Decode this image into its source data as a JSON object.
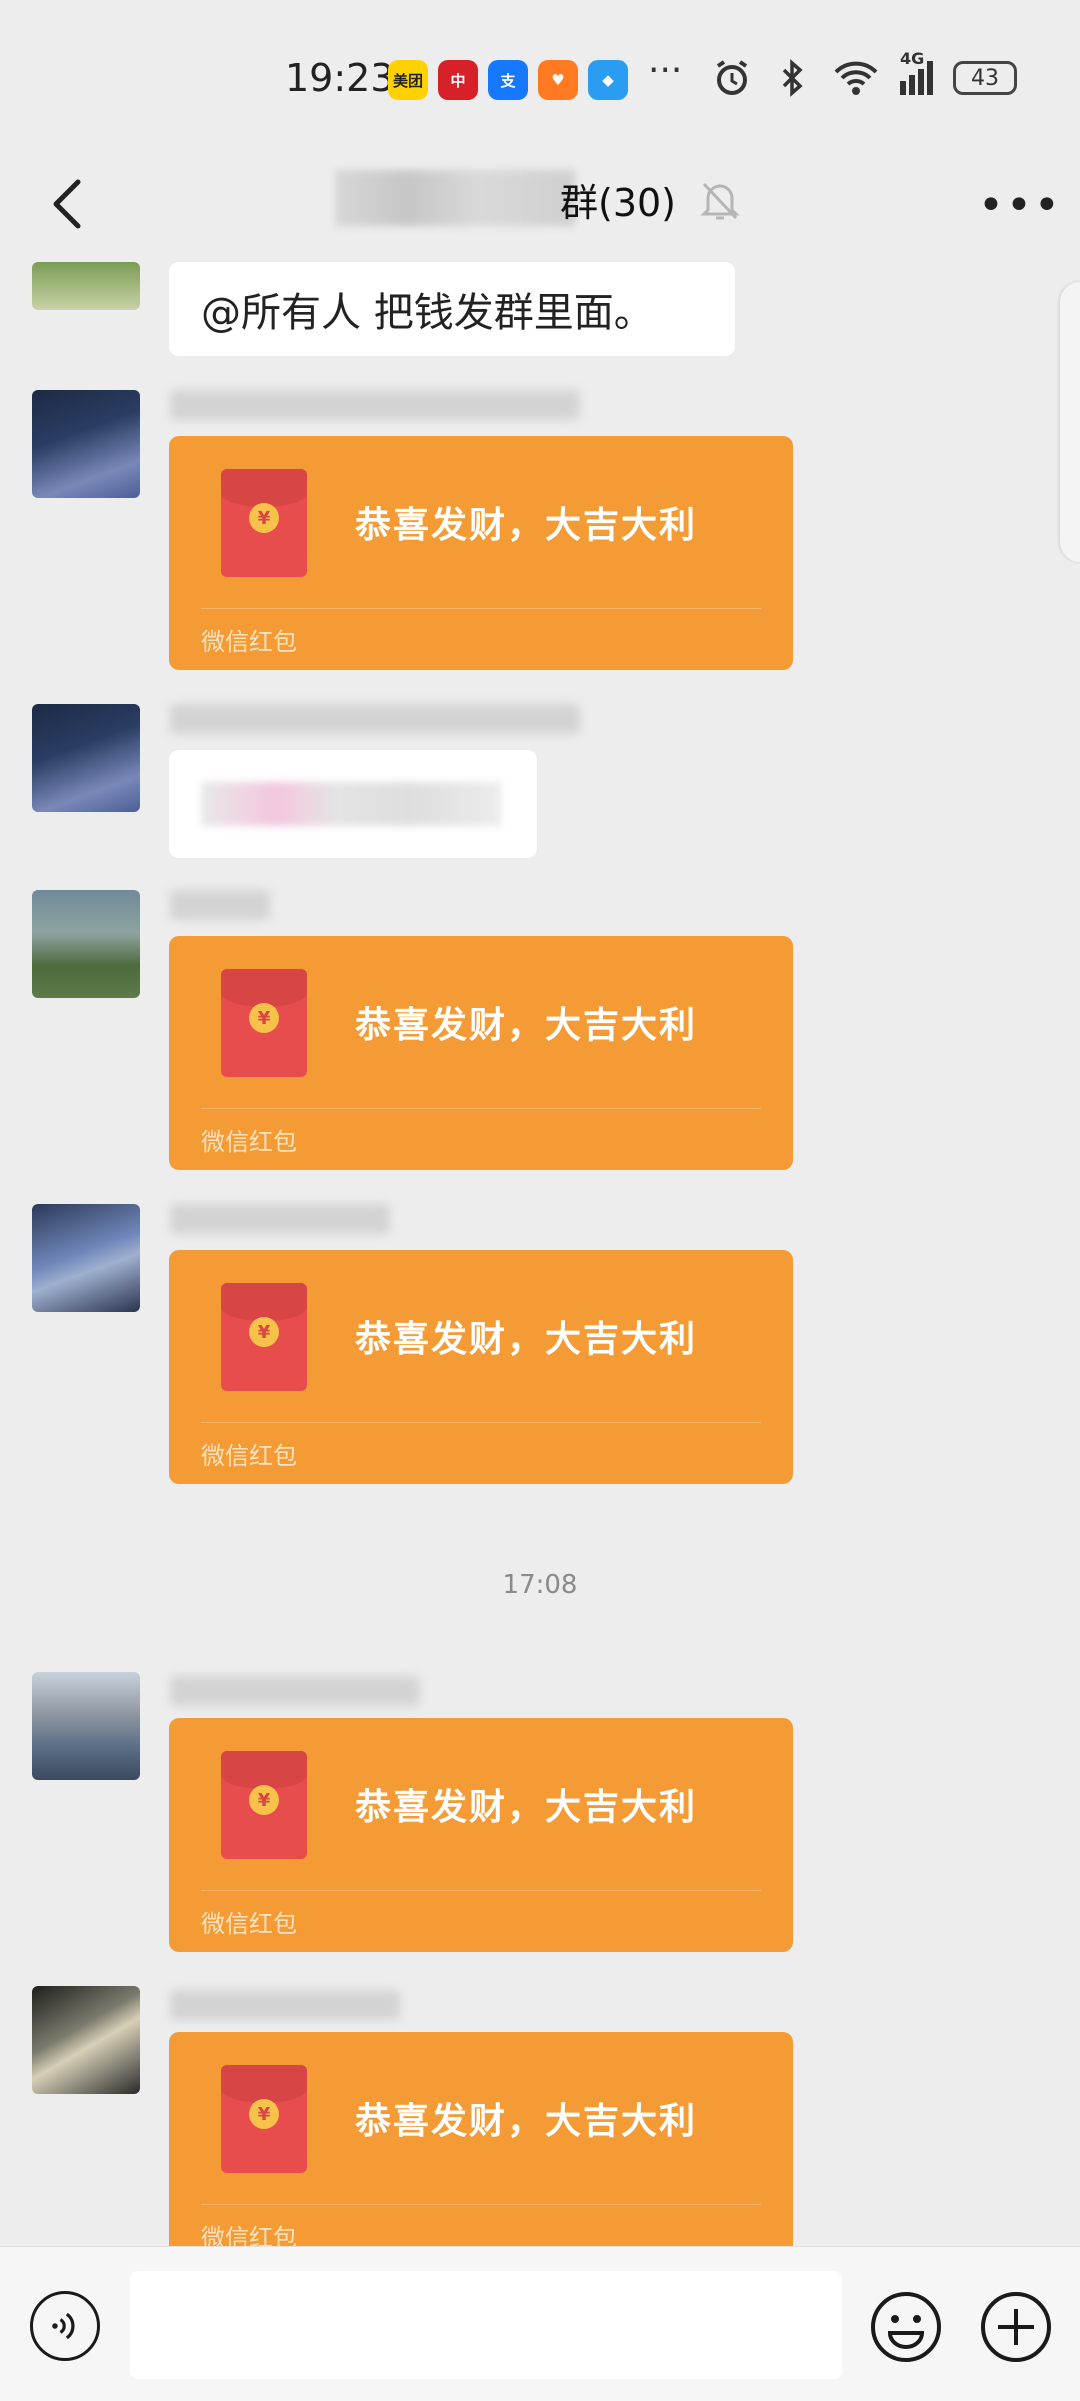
{
  "status_bar": {
    "time": "19:23",
    "apps": [
      {
        "name": "meituan-app-icon",
        "label": "美团",
        "color": "#ffd100",
        "text_color": "#222"
      },
      {
        "name": "bank-app-icon",
        "label": "中",
        "color": "#d6202a",
        "text_color": "#fff"
      },
      {
        "name": "alipay-app-icon",
        "label": "支",
        "color": "#1677ff",
        "text_color": "#fff"
      },
      {
        "name": "heart-app-icon",
        "label": "♥",
        "color": "#ff7a20",
        "text_color": "#fff"
      },
      {
        "name": "browser-app-icon",
        "label": "◆",
        "color": "#2a9cf2",
        "text_color": "#fff"
      }
    ],
    "more_apps": "···",
    "network": "4G",
    "battery": "43"
  },
  "header": {
    "title": "群(30)"
  },
  "messages": {
    "first_text": "@所有人  把钱发群里面。",
    "red_packet_greeting": "恭喜发财，大吉大利",
    "red_packet_footer": "微信红包",
    "timestamp": "17:08"
  },
  "colors": {
    "red_packet": "#f59b35",
    "envelope": "#e84d4d",
    "background": "#ededed"
  }
}
